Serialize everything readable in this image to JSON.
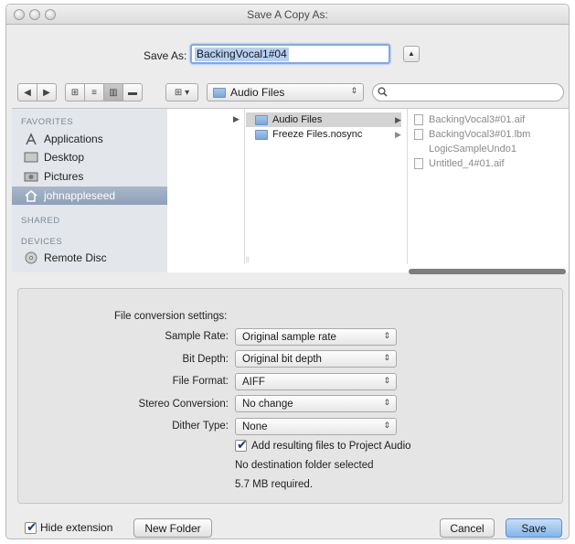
{
  "window": {
    "title": "Save A Copy As:"
  },
  "save_as": {
    "label": "Save As:",
    "value": "BackingVocal1#04",
    "expand_glyph": "▲"
  },
  "toolbar": {
    "back_glyph": "◀",
    "forward_glyph": "▶",
    "icon_view_glyph": "⊞",
    "list_view_glyph": "≡",
    "column_view_glyph": "▥",
    "coverflow_view_glyph": "▬",
    "arrange_glyph": "⊞ ▾",
    "location": "Audio Files",
    "search_placeholder": ""
  },
  "sidebar": {
    "favorites_heading": "FAVORITES",
    "favorites": [
      {
        "label": "Applications",
        "icon": "applications-icon"
      },
      {
        "label": "Desktop",
        "icon": "desktop-icon"
      },
      {
        "label": "Pictures",
        "icon": "pictures-icon"
      },
      {
        "label": "johnappleseed",
        "icon": "home-icon",
        "selected": true
      }
    ],
    "shared_heading": "SHARED",
    "devices_heading": "DEVICES",
    "devices": [
      {
        "label": "Remote Disc",
        "icon": "disc-icon"
      }
    ]
  },
  "browser": {
    "column2": [
      {
        "label": "Audio Files",
        "selected": true
      },
      {
        "label": "Freeze Files.nosync",
        "selected": false
      }
    ],
    "column3": [
      {
        "label": "BackingVocal3#01.aif"
      },
      {
        "label": "BackingVocal3#01.lbm"
      },
      {
        "label": "LogicSampleUndo1"
      },
      {
        "label": "Untitled_4#01.aif"
      }
    ]
  },
  "conversion": {
    "heading": "File conversion settings:",
    "settings": [
      {
        "label": "Sample Rate:",
        "value": "Original sample rate"
      },
      {
        "label": "Bit Depth:",
        "value": "Original bit depth"
      },
      {
        "label": "File Format:",
        "value": "AIFF"
      },
      {
        "label": "Stereo Conversion:",
        "value": "No change"
      },
      {
        "label": "Dither Type:",
        "value": "None"
      }
    ],
    "add_to_project_label": "Add resulting files to Project Audio",
    "add_to_project_checked": true,
    "destination_note": "No destination folder selected",
    "size_note": "5.7 MB required."
  },
  "footer": {
    "hide_extension_label": "Hide extension",
    "hide_extension_checked": true,
    "new_folder_label": "New Folder",
    "cancel_label": "Cancel",
    "save_label": "Save"
  },
  "colors": {
    "accent": "#7ea9e6",
    "selection": "#b6d0f2",
    "sidebar_selected": "#99a8be"
  }
}
